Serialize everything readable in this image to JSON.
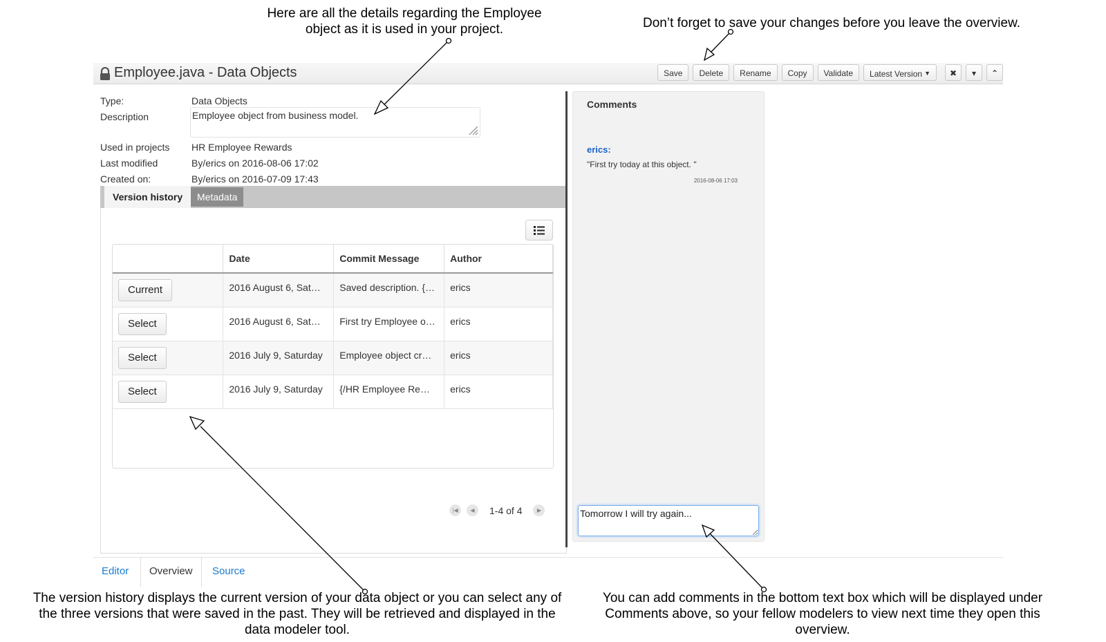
{
  "annotations": {
    "top_left": "Here are all the details regarding the Employee object as it is used in your project.",
    "top_right": "Don’t forget to save your changes before you leave the overview.",
    "bottom_left": "The version history displays the current version of your data object or you can select any of the three versions that were saved in the past. They will be retrieved and displayed in the data modeler tool.",
    "bottom_right": "You can add comments in the bottom text box which will be displayed under Comments above, so your fellow modelers to view next time they open this overview."
  },
  "header": {
    "title": "Employee.java - Data Objects",
    "lock_icon": "lock-icon",
    "toolbar": {
      "save": "Save",
      "delete": "Delete",
      "rename": "Rename",
      "copy": "Copy",
      "validate": "Validate",
      "version": "Latest Version",
      "close": "✖",
      "collapse_menu": "▾",
      "maximize": "⌃"
    }
  },
  "info": {
    "type_label": "Type:",
    "type_value": "Data Objects",
    "description_label": "Description",
    "description_value": "Employee object from business model.",
    "used_label": "Used in projects",
    "used_value": "HR Employee Rewards",
    "modified_label": "Last modified",
    "modified_value": "By/erics on 2016-08-06 17:02",
    "created_label": "Created on:",
    "created_value": "By/erics on 2016-07-09 17:43"
  },
  "tabs": {
    "version_history": "Version history",
    "metadata": "Metadata"
  },
  "history": {
    "columns": [
      "",
      "Date",
      "Commit Message",
      "Author"
    ],
    "rows": [
      {
        "button": "Current",
        "date": "2016 August 6, Sat…",
        "message": "Saved description. {…",
        "author": "erics"
      },
      {
        "button": "Select",
        "date": "2016 August 6, Sat…",
        "message": "First try Employee o…",
        "author": "erics"
      },
      {
        "button": "Select",
        "date": "2016 July 9, Saturday",
        "message": "Employee object cr…",
        "author": "erics"
      },
      {
        "button": "Select",
        "date": "2016 July 9, Saturday",
        "message": "{/HR Employee Re…",
        "author": "erics"
      }
    ],
    "pager": "1-4 of 4"
  },
  "comments": {
    "title": "Comments",
    "author": "erics:",
    "text": "\"First try today at this object. \"",
    "date": "2016-08-06 17:03",
    "input_value": "Tomorrow I will try again..."
  },
  "bottom_tabs": {
    "editor": "Editor",
    "overview": "Overview",
    "source": "Source"
  },
  "colors": {
    "link": "#1a7bd0",
    "comment_author": "#1a62c7",
    "tab_bar": "#c6c6c6",
    "metadata_tab": "#8d8d8d"
  }
}
